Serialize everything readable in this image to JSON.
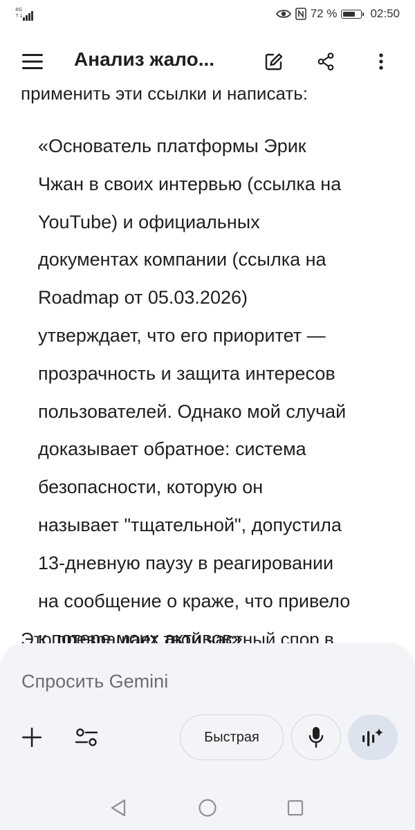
{
  "status_bar": {
    "network_top": "4G",
    "network_bottom": "↑↓",
    "battery_percent": "72 %",
    "battery_level": 0.72,
    "time": "02:50",
    "icons": [
      "eye-icon",
      "nfc-icon",
      "battery-icon"
    ]
  },
  "app_bar": {
    "title": "Анализ жало...",
    "icons": [
      "menu-icon",
      "edit-icon",
      "share-icon",
      "more-vert-icon"
    ]
  },
  "content": {
    "previous_line": "применить эти ссылки и написать:",
    "quote_lines": [
      "«Основатель платформы Эрик",
      "Чжан в своих интервью (ссылка на",
      "YouTube) и официальных",
      "документах компании (ссылка на",
      "Roadmap от 05.03.2026)",
      "утверждает, что его приоритет —",
      "прозрачность и защита интересов",
      "пользователей. Однако мой случай",
      "доказывает обратное: система",
      "безопасности, которую он",
      "называет \"тщательной\", допустила",
      "13-дневную паузу в реагировании",
      "на сообщение о краже, что привело",
      "к потере моих активов»."
    ],
    "next_line": "Это превращает твой частный спор в"
  },
  "composer": {
    "placeholder": "Спросить Gemini",
    "mode_label": "Быстрая",
    "icons": [
      "add-icon",
      "tune-icon",
      "mic-icon",
      "live-icon"
    ]
  },
  "nav_bar": {
    "icons": [
      "back-icon",
      "home-icon",
      "recents-icon"
    ]
  },
  "colors": {
    "background": "#ffffff",
    "text": "#1f1f1f",
    "composer_bg": "#f3f4f7",
    "placeholder": "#6a6d71",
    "live_button": "#dde3ee"
  }
}
